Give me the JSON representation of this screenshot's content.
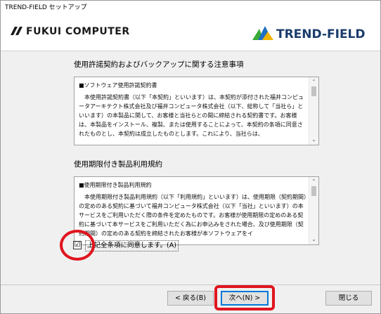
{
  "window": {
    "title": "TREND-FIELD セットアップ"
  },
  "header": {
    "logo_left": "FUKUI COMPUTER",
    "logo_right": "TREND-FIELD"
  },
  "license_section": {
    "title": "使用許諾契約およびバックアップに関する注意事項",
    "heading": "■ソフトウェア使用許諾契約書",
    "body": "本使用許諾契約書（以下「本契約」といいます）は、本契約が添付された福井コンピュータアーキテクト株式会社及び福井コンピュータ株式会社（以下、総称して「当社ら」といいます）の本製品に関して、お客様と当社らとの間に締結される契約書です。お客様は、本製品をインストール、複製、または使用することによって、本契約の条項に同意されたものとし、本契約は成立したものとします。これにより、当社らは、"
  },
  "term_section": {
    "title": "使用期限付き製品利用規約",
    "heading": "■使用期限付き製品利用規約",
    "body": "本使用期限付き製品利用規約（以下「利用規約」といいます）は、使用期限（契約期間）の定めのある契約に基づいて福井コンピュータ株式会社（以下「当社」といいます）の本サービスをご利用いただく際の条件を定めたものです。お客様が使用期限の定めのある契約に基づいて本サービスをご利用いただく為にお申込みをされた場合、及び使用期限（契約期間）の定めのある契約を締結されたお客様が本ソフトウェアをイ"
  },
  "agree": {
    "checked": true,
    "check_glyph": "☑",
    "label": "上記全条項に同意します。(A)"
  },
  "buttons": {
    "back": "< 戻る(B)",
    "next": "次へ(N) >",
    "close": "閉じる"
  },
  "colors": {
    "highlight": "#e0141e",
    "trend_blue": "#1b3c6c"
  }
}
